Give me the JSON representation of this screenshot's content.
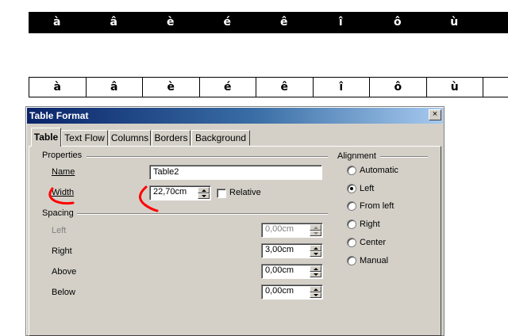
{
  "document": {
    "table_top": [
      "à",
      "â",
      "è",
      "é",
      "ê",
      "î",
      "ô",
      "ù"
    ],
    "table_bottom": [
      "à",
      "â",
      "è",
      "é",
      "ê",
      "î",
      "ô",
      "ù"
    ]
  },
  "dialog": {
    "title": "Table Format",
    "close_glyph": "×",
    "tabs": [
      "Table",
      "Text Flow",
      "Columns",
      "Borders",
      "Background"
    ],
    "properties": {
      "group": "Properties",
      "name_label": "Name",
      "name_value": "Table2",
      "width_label": "Width",
      "width_value": "22,70cm",
      "relative_label": "Relative"
    },
    "spacing": {
      "group": "Spacing",
      "left_label": "Left",
      "left_value": "0,00cm",
      "right_label": "Right",
      "right_value": "3,00cm",
      "above_label": "Above",
      "above_value": "0,00cm",
      "below_label": "Below",
      "below_value": "0,00cm"
    },
    "alignment": {
      "group": "Alignment",
      "options": [
        "Automatic",
        "Left",
        "From left",
        "Right",
        "Center",
        "Manual"
      ],
      "selected": "Left"
    }
  },
  "colors": {
    "annotation": "#ff0000",
    "titlebar_start": "#0a246a",
    "titlebar_end": "#a6caf0"
  }
}
